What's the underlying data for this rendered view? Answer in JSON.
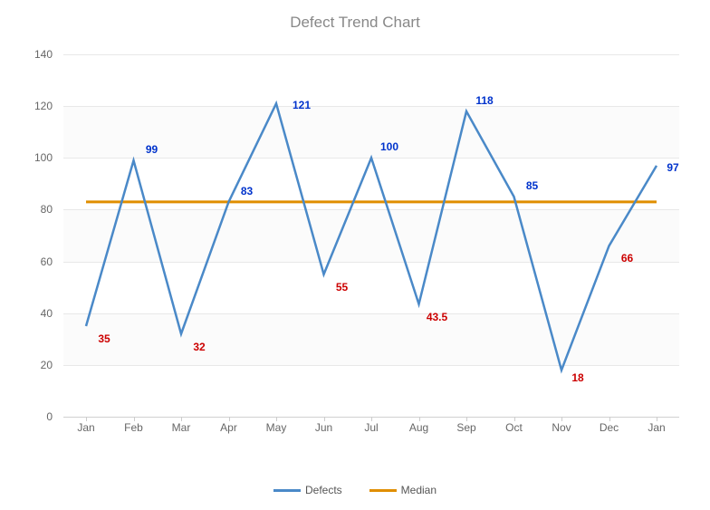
{
  "chart_data": {
    "type": "line",
    "title": "Defect Trend Chart",
    "xlabel": "",
    "ylabel": "",
    "ylim": [
      0,
      140
    ],
    "y_ticks": [
      0,
      20,
      40,
      60,
      80,
      100,
      120,
      140
    ],
    "categories": [
      "Jan",
      "Feb",
      "Mar",
      "Apr",
      "May",
      "Jun",
      "Jul",
      "Aug",
      "Sep",
      "Oct",
      "Nov",
      "Dec",
      "Jan"
    ],
    "series": [
      {
        "name": "Defects",
        "color": "#4A89C8",
        "values": [
          35,
          99,
          32,
          83,
          121,
          55,
          100,
          43.5,
          118,
          85,
          18,
          66,
          97
        ]
      },
      {
        "name": "Median",
        "color": "#E08E00",
        "values": [
          83,
          83,
          83,
          83,
          83,
          83,
          83,
          83,
          83,
          83,
          83,
          83,
          83
        ]
      }
    ],
    "data_labels": [
      {
        "i": 0,
        "text": "35",
        "pos": "below"
      },
      {
        "i": 1,
        "text": "99",
        "pos": "above"
      },
      {
        "i": 2,
        "text": "32",
        "pos": "below"
      },
      {
        "i": 3,
        "text": "83",
        "pos": "above"
      },
      {
        "i": 4,
        "text": "121",
        "pos": "above"
      },
      {
        "i": 5,
        "text": "55",
        "pos": "below"
      },
      {
        "i": 6,
        "text": "100",
        "pos": "above"
      },
      {
        "i": 7,
        "text": "43.5",
        "pos": "below"
      },
      {
        "i": 8,
        "text": "118",
        "pos": "above"
      },
      {
        "i": 9,
        "text": "85",
        "pos": "above"
      },
      {
        "i": 10,
        "text": "18",
        "pos": "below"
      },
      {
        "i": 11,
        "text": "66",
        "pos": "below"
      },
      {
        "i": 12,
        "text": "97",
        "pos": "above"
      }
    ],
    "legend_position": "bottom"
  }
}
